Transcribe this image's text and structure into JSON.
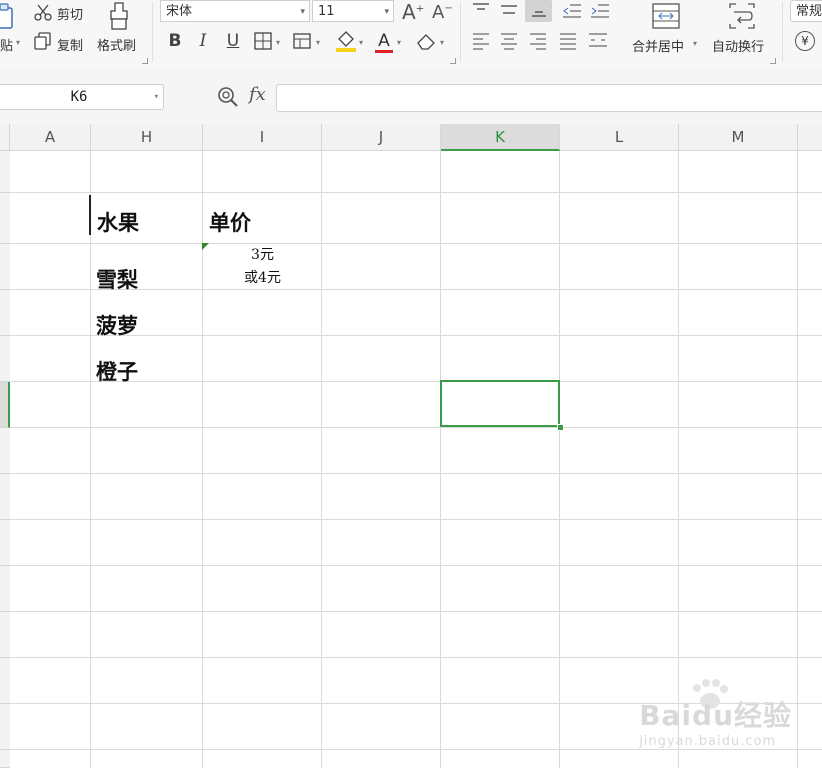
{
  "ribbon": {
    "clipboard": {
      "paste_label": "贴",
      "cut_label": "剪切",
      "copy_label": "复制",
      "format_painter_label": "格式刷"
    },
    "font": {
      "name": "宋体",
      "size": "11",
      "increase_label": "A",
      "decrease_label": "A",
      "bold_label": "B",
      "italic_label": "I",
      "underline_label": "U",
      "font_color_label": "A"
    },
    "alignment": {
      "merge_center_label": "合并居中",
      "wrap_text_label": "自动换行"
    },
    "number": {
      "format_label": "常规",
      "currency_symbol": "¥"
    }
  },
  "formula_bar": {
    "name_box": "K6",
    "fx_label": "fx",
    "formula": ""
  },
  "grid": {
    "columns": [
      "A",
      "H",
      "I",
      "J",
      "K",
      "L",
      "M"
    ],
    "active_column": "K",
    "active_cell": "K6",
    "cells": {
      "h_header": "水果",
      "i_header": "单价",
      "fruit_1": "雪梨",
      "fruit_2": "菠萝",
      "fruit_3": "橙子",
      "price_line1": "3元",
      "price_line2": "或4元"
    }
  },
  "watermark": {
    "text": "Baidu经验",
    "url_text": "jingyan.baidu.com"
  },
  "colors": {
    "accent_green": "#3a9c47",
    "header_bg": "#f2f2f2",
    "grid_line": "#dadada"
  }
}
